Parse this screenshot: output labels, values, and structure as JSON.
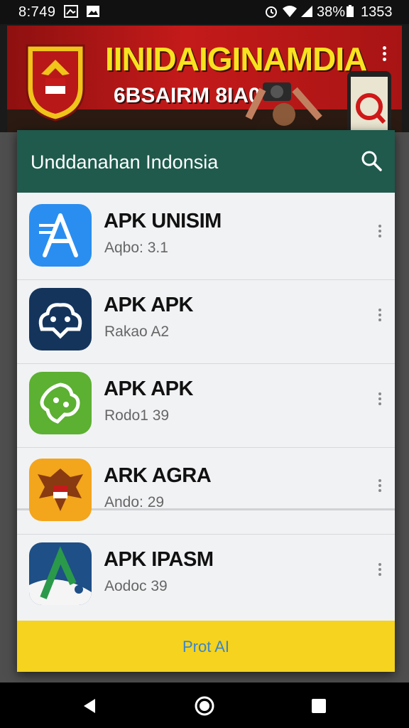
{
  "status_bar": {
    "time": "8:749",
    "battery_pct": "38%",
    "clock_right": "1353",
    "icons": [
      "image-icon",
      "photo-icon",
      "alarm-icon",
      "wifi-icon",
      "signal-icon",
      "battery-icon"
    ]
  },
  "banner": {
    "title": "IINIDAIGINAMDIA",
    "subtitle": "6BSAIRM 8IA0",
    "colors": {
      "background": "#c41a1a",
      "title": "#f7e31f"
    }
  },
  "dialog": {
    "title": "Unddanahan Indonsia",
    "header_color": "#1f5a4c",
    "search_icon": "search-icon",
    "apps": [
      {
        "name": "APK UNISIM",
        "subtitle": "Aqbo: 3.1",
        "icon": "app-a-blue-icon",
        "icon_color": "#2a8ef0"
      },
      {
        "name": "APK APK",
        "subtitle": "Rakao A2",
        "icon": "gamepad-cloud-icon",
        "icon_color": "#14345c"
      },
      {
        "name": "APK APK",
        "subtitle": "Rodo1 39",
        "icon": "green-blob-icon",
        "icon_color": "#5cb032"
      },
      {
        "name": "ARK AGRA",
        "subtitle": "Ando: 29",
        "icon": "garuda-icon",
        "icon_color": "#f3a51c"
      },
      {
        "name": "APK IPASM",
        "subtitle": "Aodoc 39",
        "icon": "letter-a-green-icon",
        "icon_color": "#1e4f86"
      }
    ],
    "footer_label": "Prot AI",
    "footer_color": "#f5d31f"
  },
  "nav_bar": {
    "buttons": [
      "back-icon",
      "home-icon",
      "recents-icon"
    ]
  }
}
